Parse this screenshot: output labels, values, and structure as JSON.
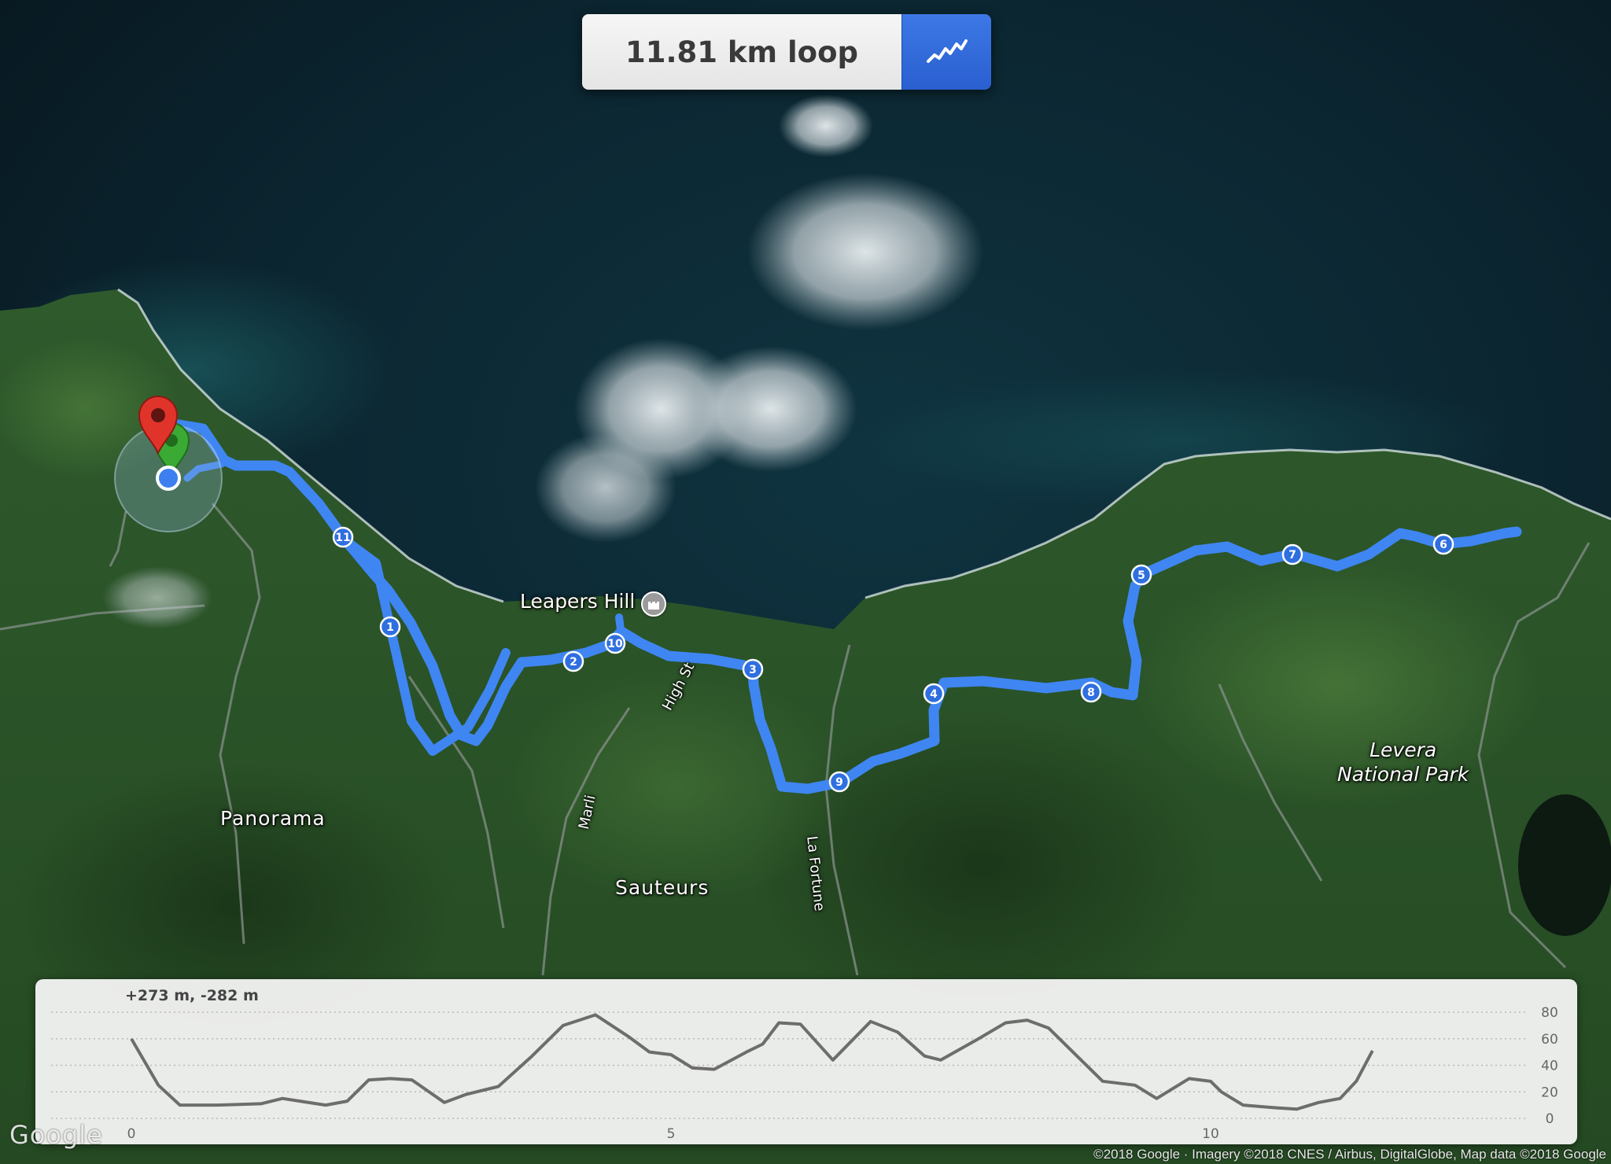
{
  "header": {
    "distance_label": "11.81 km loop",
    "chart_button_icon": "elevation-line-icon",
    "accent_color": "#2f66d8"
  },
  "map": {
    "imagery": "satellite",
    "route_color": "#3f86f2",
    "labels": {
      "leapers_hill": "Leapers Hill",
      "panorama": "Panorama",
      "sauteurs": "Sauteurs",
      "levera_line1": "Levera",
      "levera_line2": "National Park",
      "high_st": "High St",
      "marli": "Marli",
      "la_fortune": "La Fortune"
    },
    "landmark_icon": "castle-icon",
    "markers": {
      "end_pin_color": "#e0342b",
      "start_pin_color": "#3aaa35",
      "current_location_color": "#3d7ff0"
    },
    "km_markers": [
      "1",
      "2",
      "3",
      "4",
      "5",
      "6",
      "7",
      "8",
      "9",
      "10",
      "11"
    ],
    "google_logo": "Google",
    "attribution": "©2018 Google · Imagery ©2018 CNES / Airbus, DigitalGlobe, Map data ©2018 Google"
  },
  "elevation": {
    "summary": "+273 m, -282 m",
    "x_ticks": [
      "0",
      "5",
      "10"
    ],
    "y_ticks": [
      "80",
      "60",
      "40",
      "20",
      "0"
    ]
  },
  "chart_data": {
    "type": "line",
    "title": "",
    "xlabel": "",
    "ylabel": "",
    "xlim": [
      0,
      11.81
    ],
    "ylim": [
      0,
      80
    ],
    "grid": true,
    "x_ticks": [
      0,
      5,
      10
    ],
    "y_ticks": [
      0,
      20,
      40,
      60,
      80
    ],
    "series": [
      {
        "x": [
          0,
          0.25,
          0.45,
          0.8,
          1.2,
          1.4,
          1.8,
          2.0,
          2.2,
          2.4,
          2.6,
          2.9,
          3.1,
          3.4,
          3.7,
          4.0,
          4.3,
          4.6,
          4.8,
          5.0,
          5.2,
          5.4,
          5.7,
          5.85,
          6.0,
          6.2,
          6.5,
          6.85,
          7.1,
          7.35,
          7.5,
          7.85,
          8.1,
          8.3,
          8.5,
          8.7,
          9.0,
          9.3,
          9.5,
          9.8,
          10.0,
          10.1,
          10.3,
          10.6,
          10.8,
          11.0,
          11.2,
          11.35,
          11.5
        ],
        "y": [
          60,
          25,
          10,
          10,
          11,
          15,
          10,
          13,
          29,
          30,
          29,
          12,
          18,
          24,
          46,
          70,
          78,
          62,
          50,
          48,
          38,
          37,
          50,
          56,
          72,
          71,
          44,
          73,
          65,
          47,
          44,
          60,
          72,
          74,
          68,
          52,
          28,
          25,
          15,
          30,
          28,
          20,
          10,
          8,
          7,
          12,
          15,
          28,
          51
        ]
      }
    ]
  }
}
